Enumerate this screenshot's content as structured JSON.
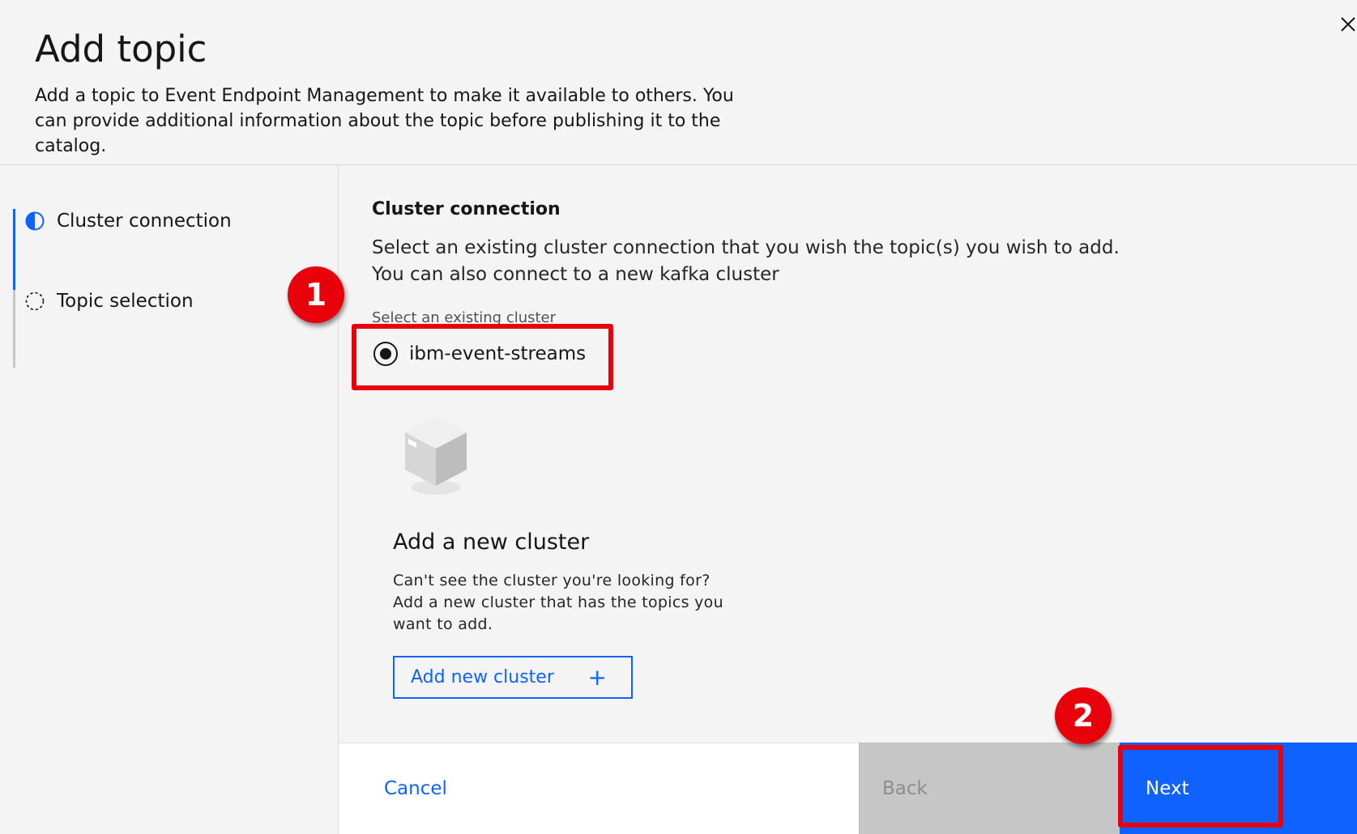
{
  "header": {
    "title": "Add topic",
    "description": "Add a topic to Event Endpoint Management to make it available to others. You can provide additional information about the topic before publishing it to the catalog."
  },
  "sidebar": {
    "steps": [
      {
        "label": "Cluster connection",
        "state": "current",
        "icon": "half-filled-circle-icon"
      },
      {
        "label": "Topic selection",
        "state": "incomplete",
        "icon": "dashed-circle-icon"
      }
    ]
  },
  "main": {
    "section_title": "Cluster connection",
    "section_description": "Select an existing cluster connection that you wish the topic(s) you wish to add. You can also connect to a new kafka cluster",
    "field_label": "Select an existing cluster",
    "clusters": [
      {
        "label": "ibm-event-streams",
        "selected": true
      }
    ],
    "new_cluster": {
      "icon": "cube-icon",
      "title": "Add a new cluster",
      "description": "Can't see the cluster you're looking for? Add a new cluster that has the topics you want to add.",
      "button_label": "Add new cluster",
      "button_icon": "+"
    }
  },
  "footer": {
    "cancel_label": "Cancel",
    "back_label": "Back",
    "next_label": "Next"
  },
  "annotations": {
    "badge_1": "1",
    "badge_2": "2",
    "color": "#e8000a"
  },
  "colors": {
    "primary": "#0f62fe",
    "background": "#f4f4f4",
    "disabled": "#c6c6c6"
  }
}
